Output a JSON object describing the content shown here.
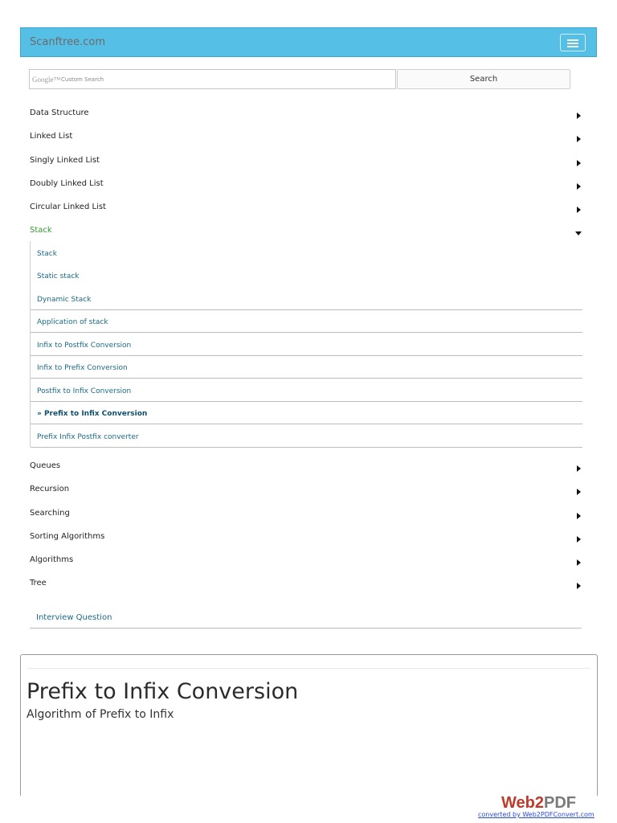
{
  "navbar": {
    "brand": "Scanftree.com",
    "menu_toggle_icon": "hamburger-icon"
  },
  "search": {
    "google_logo": "Google™",
    "custom_search": "Custom Search",
    "button_label": "Search"
  },
  "menu": {
    "items_top": [
      {
        "label": "Data Structure"
      },
      {
        "label": "Linked List"
      },
      {
        "label": "Singly Linked List"
      },
      {
        "label": "Doubly Linked List"
      },
      {
        "label": "Circular Linked List"
      }
    ],
    "active": {
      "label": "Stack"
    },
    "submenu": [
      {
        "label": "Stack"
      },
      {
        "label": "Static stack"
      },
      {
        "label": "Dynamic Stack"
      },
      {
        "label": "Application of stack"
      },
      {
        "label": "Infix to Postfix Conversion"
      },
      {
        "label": "Infix to Prefix Conversion"
      },
      {
        "label": "Postfix to Infix Conversion"
      },
      {
        "label": "» Prefix to Infix Conversion"
      },
      {
        "label": "Prefix Infix Postfix converter"
      }
    ],
    "items_bottom": [
      {
        "label": "Queues"
      },
      {
        "label": "Recursion"
      },
      {
        "label": "Searching"
      },
      {
        "label": "Sorting Algorithms"
      },
      {
        "label": "Algorithms"
      },
      {
        "label": "Tree"
      }
    ],
    "interview": "Interview Question"
  },
  "content": {
    "title": "Prefix to Infix Conversion",
    "subtitle": "Algorithm of Prefix to Infix"
  },
  "footer": {
    "logo_web": "Web2",
    "logo_pdf": "PDF",
    "converted_by": "converted by Web2PDFConvert.com"
  },
  "colors": {
    "navbar": "#56bfe6",
    "active_menu": "#2e9a2e",
    "link": "#1a6a8a"
  }
}
